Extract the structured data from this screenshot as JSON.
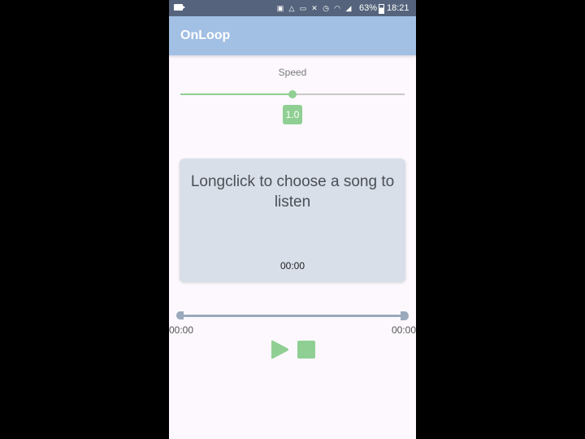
{
  "status_bar": {
    "battery_percent": "63%",
    "time": "18:21",
    "icons": [
      "video-icon",
      "sim-icon",
      "warning-icon",
      "cast-icon",
      "mute-icon",
      "alarm-icon",
      "wifi-icon",
      "signal-icon",
      "battery-icon"
    ]
  },
  "app_bar": {
    "title": "OnLoop"
  },
  "speed": {
    "label": "Speed",
    "value": "1.0",
    "fraction": 0.5
  },
  "song_card": {
    "prompt": "Longclick to choose a song to listen",
    "time": "00:00"
  },
  "progress": {
    "start_time": "00:00",
    "end_time": "00:00",
    "fraction": 0
  },
  "colors": {
    "app_bar": "#a2bfe4",
    "accent_green": "#8fcf93",
    "status_bar": "#55647c",
    "card": "#d8dfe9"
  }
}
